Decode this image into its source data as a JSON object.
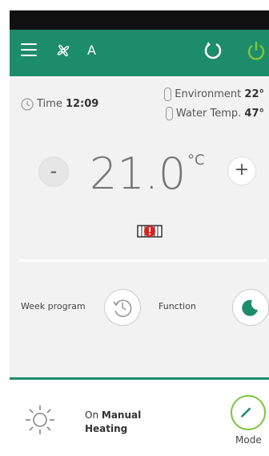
{
  "header": {
    "mode_letter": "A"
  },
  "info": {
    "time_label": "Time",
    "time_value": "12:09",
    "environment_label": "Environment",
    "environment_value": "22°",
    "water_label": "Water Temp.",
    "water_value": "47°"
  },
  "setpoint": {
    "value": "21.0",
    "unit": "°C",
    "minus_label": "-",
    "plus_label": "+"
  },
  "controls": {
    "week_program_label": "Week program",
    "function_label": "Function"
  },
  "status": {
    "on_label": "On",
    "mode_name": "Manual",
    "function_name": "Heating",
    "mode_button_label": "Mode"
  },
  "colors": {
    "accent": "#1d8c6b",
    "power_icon": "#7cc43e",
    "alert": "#d9231f"
  }
}
